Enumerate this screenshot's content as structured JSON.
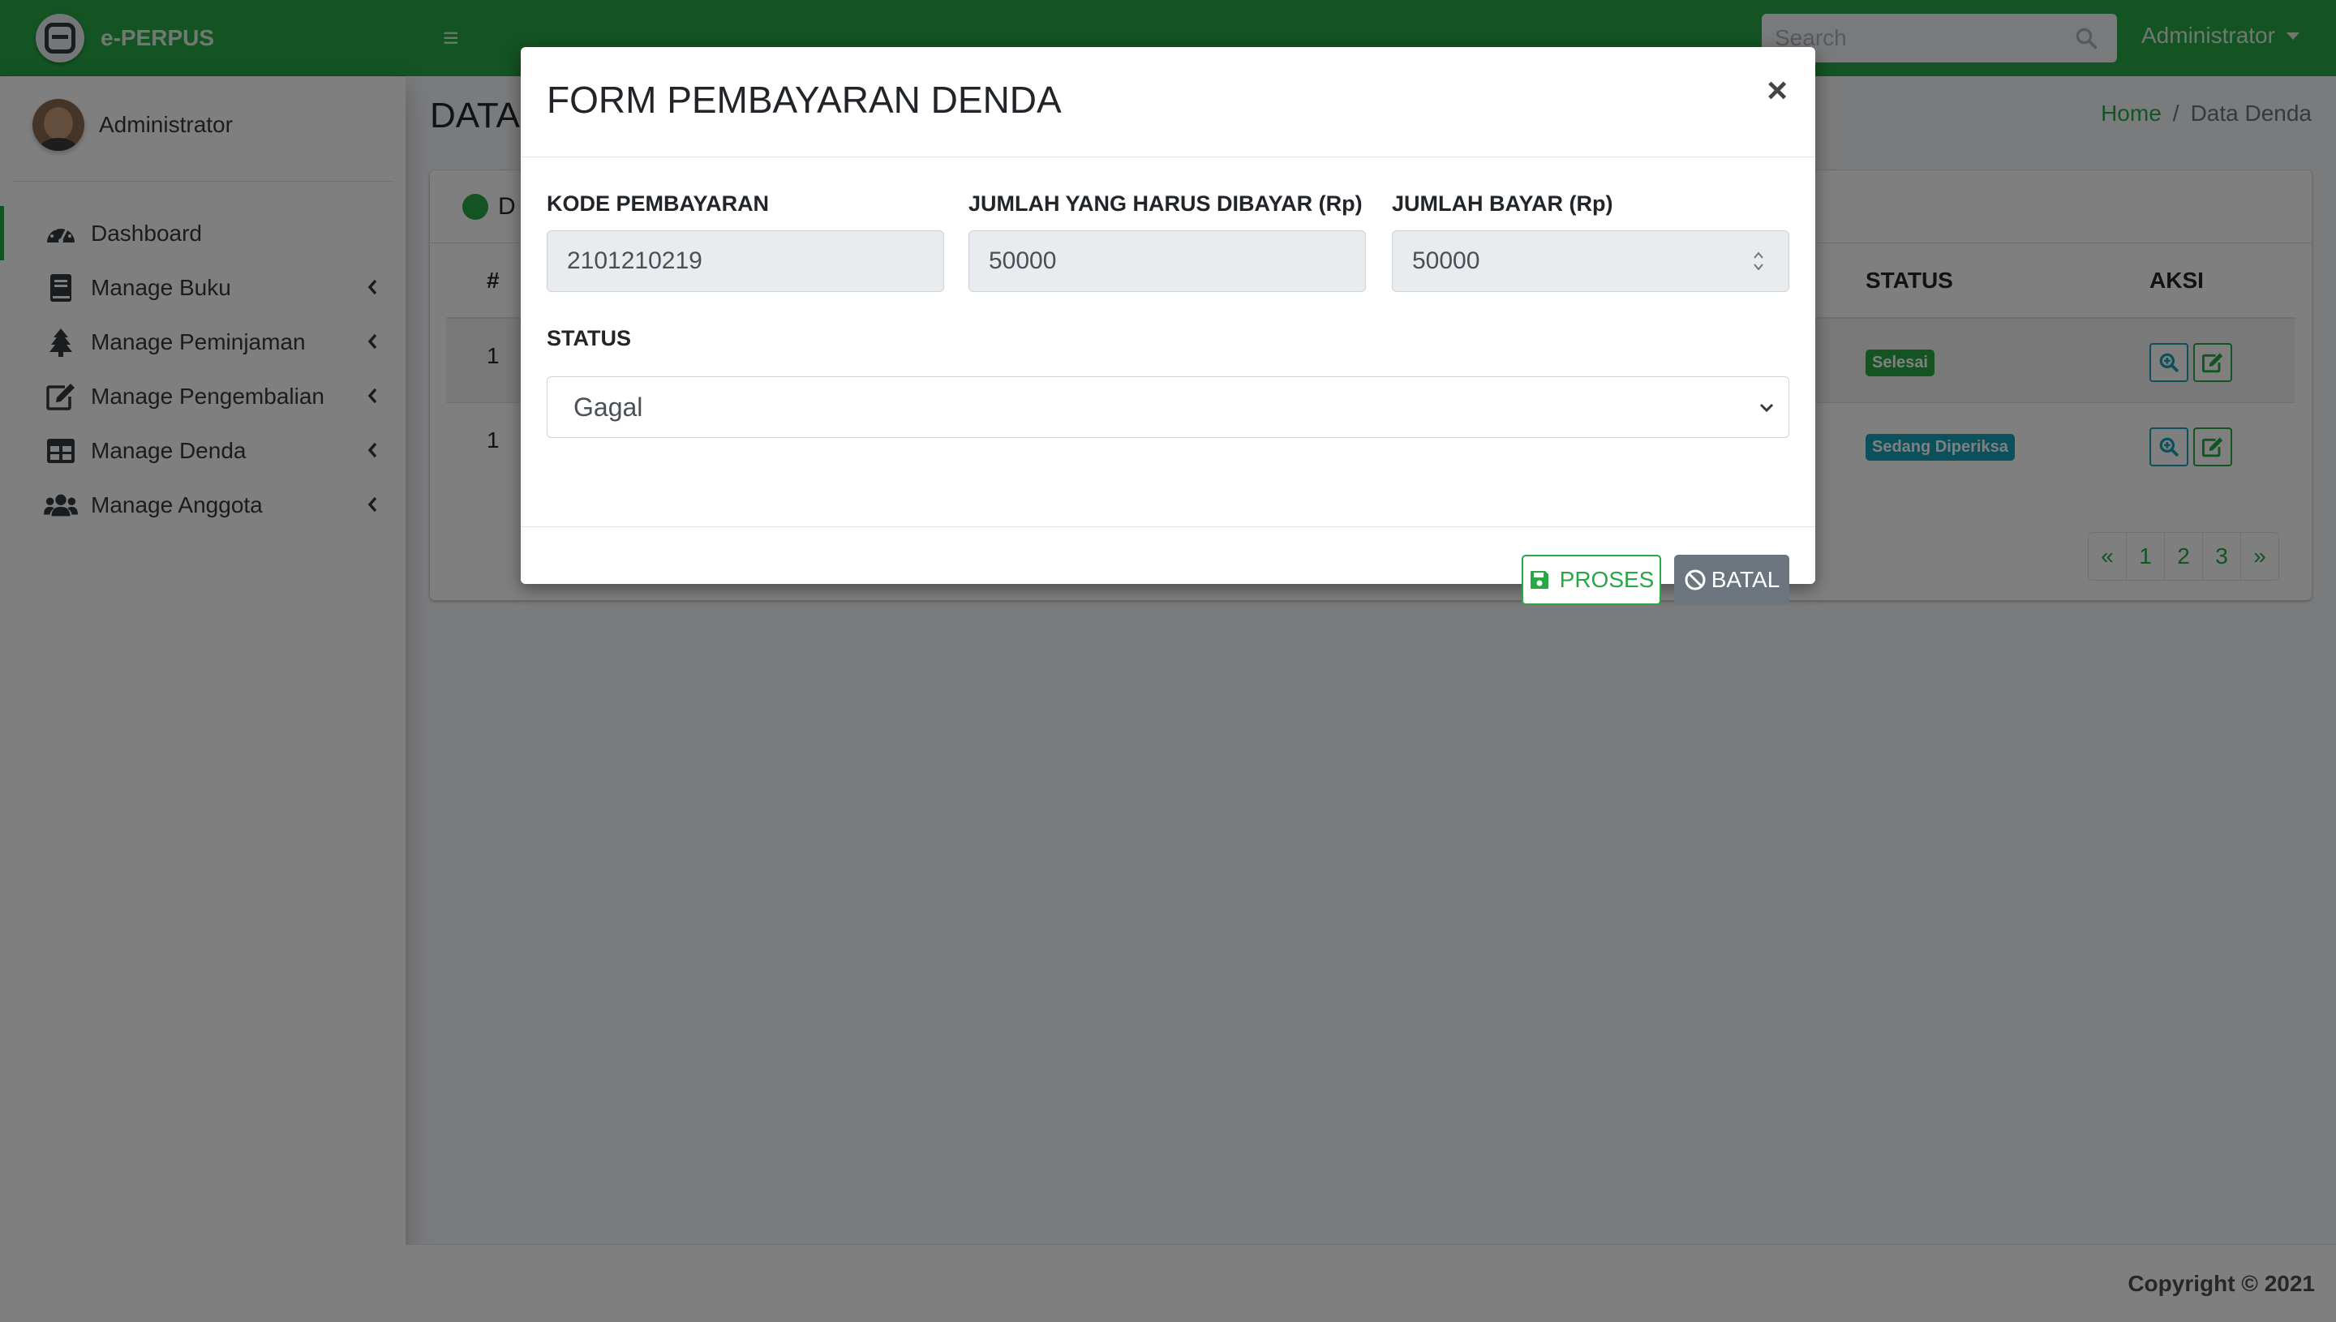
{
  "app": {
    "brand": "e-PERPUS"
  },
  "navbar": {
    "search_placeholder": "Search",
    "user": "Administrator"
  },
  "sidebar": {
    "user_name": "Administrator",
    "items": [
      {
        "label": "Dashboard",
        "icon": "tachometer-icon",
        "active": true
      },
      {
        "label": "Manage Buku",
        "icon": "book-icon"
      },
      {
        "label": "Manage Peminjaman",
        "icon": "tree-icon"
      },
      {
        "label": "Manage Pengembalian",
        "icon": "edit-icon"
      },
      {
        "label": "Manage Denda",
        "icon": "table-icon"
      },
      {
        "label": "Manage Anggota",
        "icon": "users-icon"
      }
    ]
  },
  "page": {
    "title": "DATA",
    "breadcrumb": {
      "home": "Home",
      "separator": "/",
      "current": "Data Denda"
    },
    "card_header": "D",
    "table": {
      "headers": {
        "no": "#",
        "status": "STATUS",
        "aksi": "AKSI"
      },
      "rows": [
        {
          "no": "1",
          "status": "Selesai",
          "status_color": "#28a745"
        },
        {
          "no": "1",
          "status": "Sedang Diperiksa",
          "status_color": "#17a2b8"
        }
      ]
    },
    "pagination": [
      "«",
      "1",
      "2",
      "3",
      "»"
    ],
    "footer": "Copyright © 2021"
  },
  "modal": {
    "title": "FORM PEMBAYARAN DENDA",
    "close": "×",
    "fields": {
      "kode_label": "KODE PEMBAYARAN",
      "kode_value": "2101210219",
      "jumlah_harus_label": "JUMLAH YANG HARUS DIBAYAR (Rp)",
      "jumlah_harus_value": "50000",
      "jumlah_bayar_label": "JUMLAH BAYAR (Rp)",
      "jumlah_bayar_value": "50000",
      "status_label": "STATUS",
      "status_value": "Gagal"
    },
    "buttons": {
      "proses": "PROSES",
      "batal": "BATAL"
    }
  },
  "colors": {
    "accent": "#28a745",
    "info": "#17a2b8",
    "secondary": "#6c757d"
  }
}
